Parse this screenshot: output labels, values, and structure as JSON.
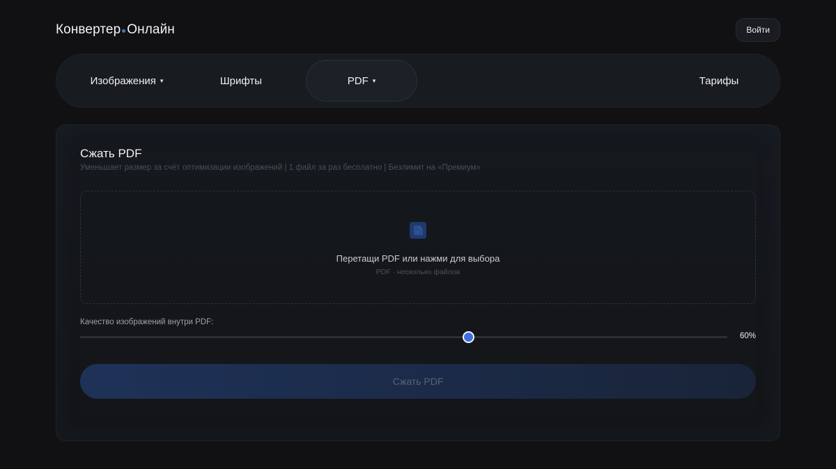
{
  "header": {
    "logo_part1": "Конвертер",
    "logo_part2": "Онлайн",
    "logo_dot_color": "#3a78c9",
    "login_label": "Войти"
  },
  "nav": {
    "items": [
      {
        "label": "Изображения",
        "has_dropdown": true,
        "active": false
      },
      {
        "label": "Шрифты",
        "has_dropdown": false,
        "active": false
      },
      {
        "label": "PDF",
        "has_dropdown": true,
        "active": true
      },
      {
        "label": "Тарифы",
        "has_dropdown": false,
        "active": false
      }
    ],
    "caret": "▾"
  },
  "card": {
    "title": "Сжать PDF",
    "subtitle": "Уменьшает размер за счёт оптимизации изображений  |  1 файл за раз бесплатно  |  Безлимит на «Премиум»",
    "dropzone": {
      "icon": "pdf-file-icon",
      "main_text": "Перетащи PDF или нажми для выбора",
      "hint_text": "PDF · несколько файлов"
    },
    "quality": {
      "label": "Качество изображений внутри PDF:",
      "value_text": "60%",
      "value": 0.6,
      "accent_color": "#3b6fe0"
    },
    "submit_label": "Сжать PDF"
  }
}
